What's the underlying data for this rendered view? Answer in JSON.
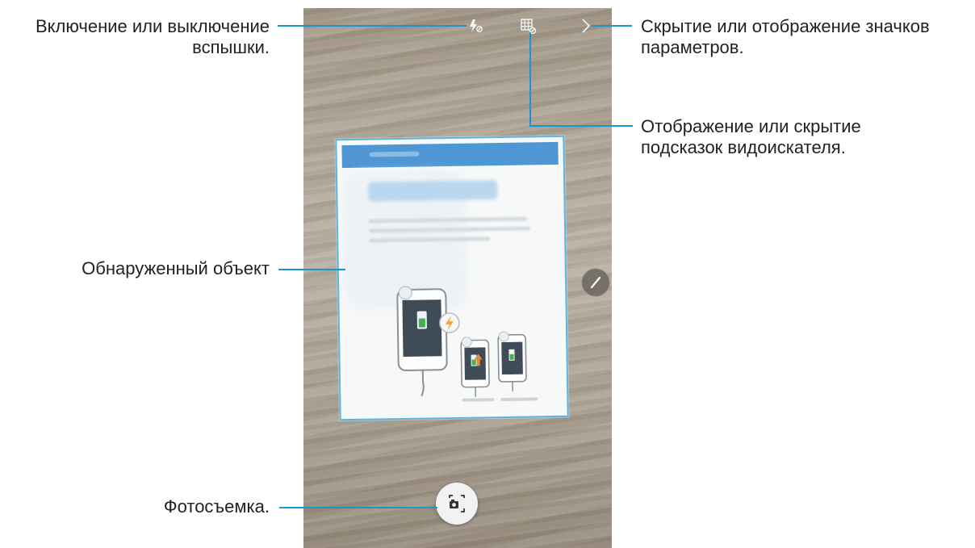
{
  "callouts": {
    "flash": [
      "Включение или выключение",
      "вспышки."
    ],
    "settings": [
      "Скрытие или отображение значков",
      "параметров."
    ],
    "guides": [
      "Отображение или скрытие",
      "подсказок видоискателя."
    ],
    "detected": "Обнаруженный объект",
    "capture": "Фотосъемка."
  },
  "icons": {
    "flash": "flash-off-icon",
    "grid": "guide-grid-icon",
    "chevron": "chevron-right-icon",
    "pen": "pen-icon",
    "shutter": "camera-icon"
  },
  "colors": {
    "callout_line": "#1b95cf",
    "document_border": "#5ab5e6",
    "document_header": "#4f97d4"
  }
}
